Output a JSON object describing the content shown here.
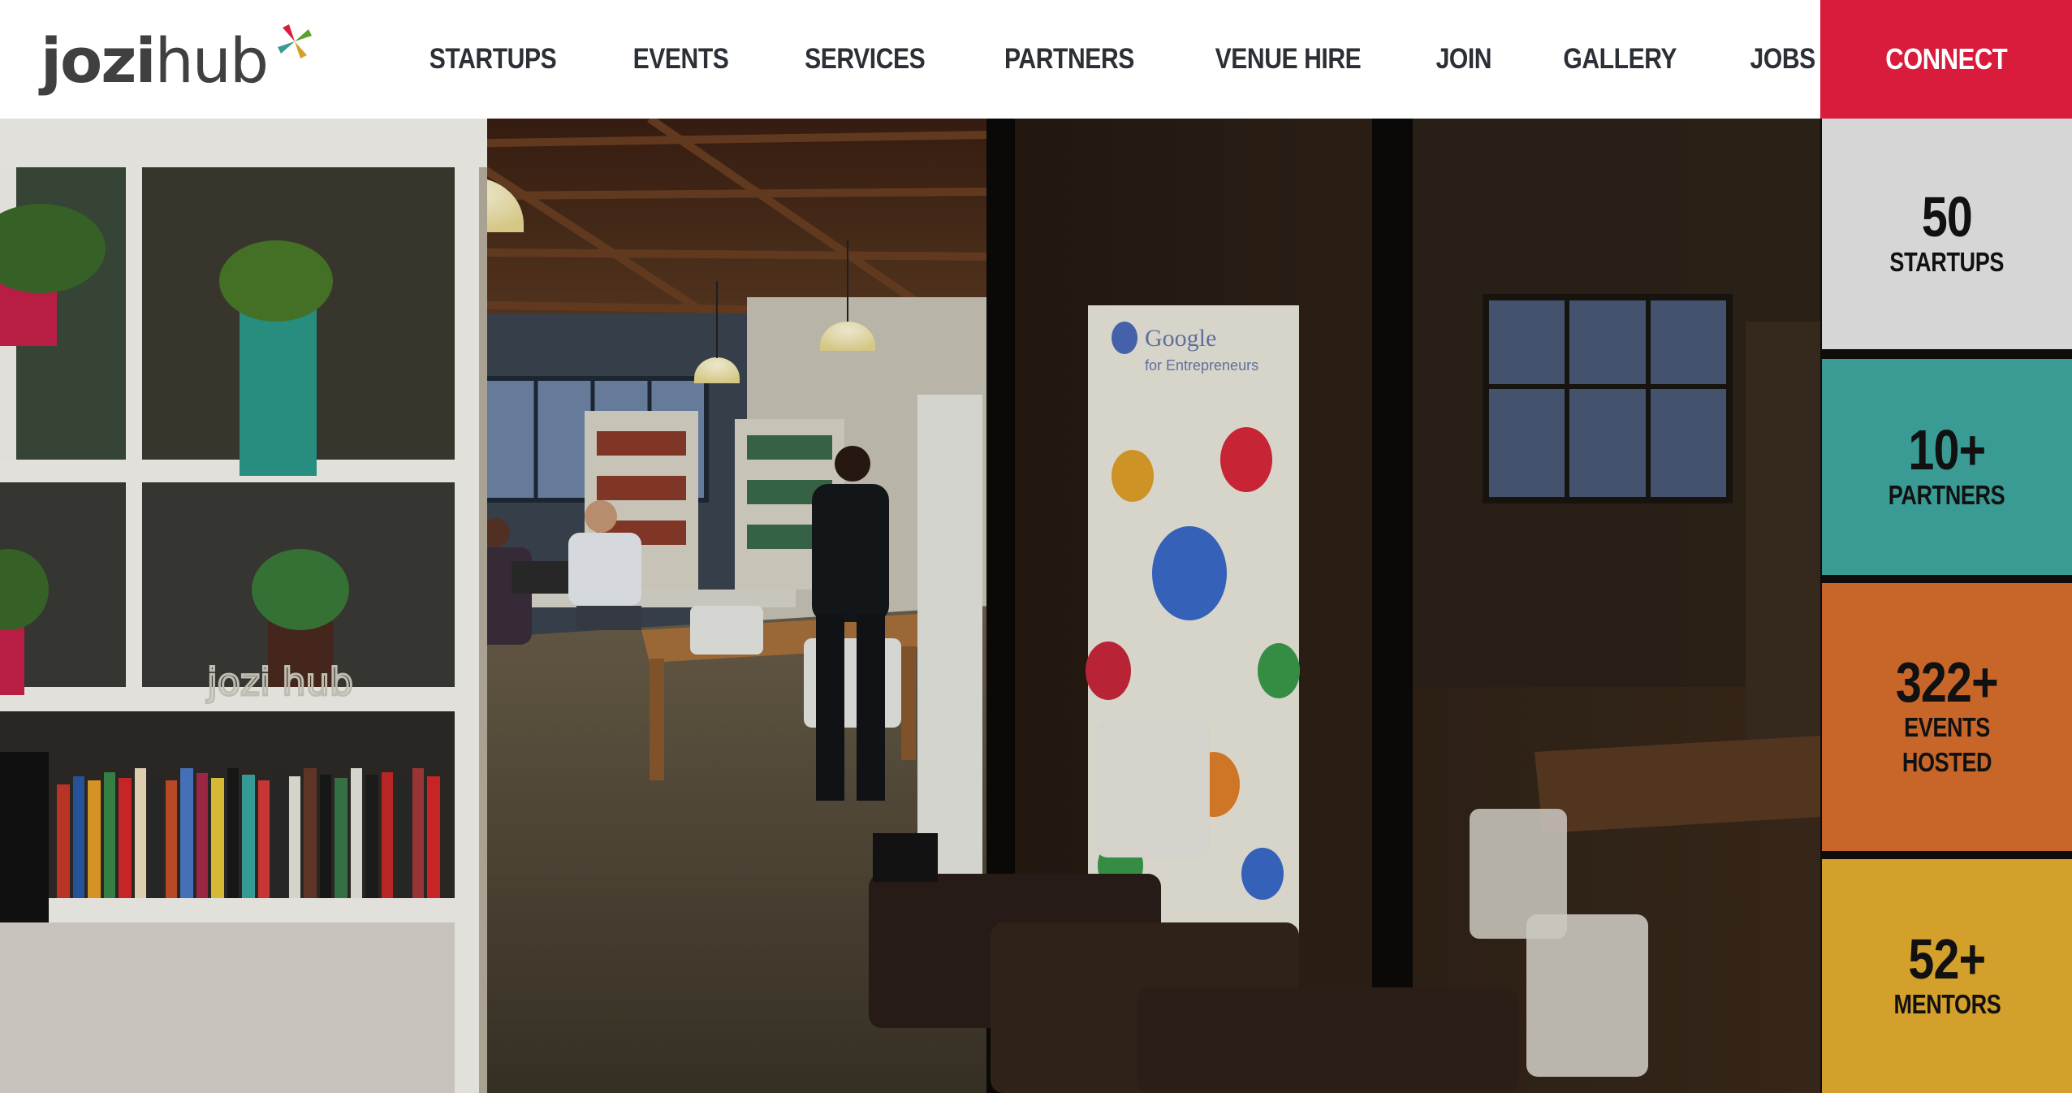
{
  "brand": {
    "logo_bold": "jozi",
    "logo_light": "hub",
    "mark_colors": [
      "#da1c3c",
      "#3a9a94",
      "#d4a02c",
      "#5aa02c"
    ]
  },
  "nav": {
    "items": [
      {
        "label": "STARTUPS"
      },
      {
        "label": "EVENTS"
      },
      {
        "label": "SERVICES"
      },
      {
        "label": "PARTNERS"
      },
      {
        "label": "VENUE HIRE"
      },
      {
        "label": "JOIN"
      },
      {
        "label": "GALLERY"
      },
      {
        "label": "JOBS"
      }
    ],
    "cta_label": "CONNECT"
  },
  "stats": [
    {
      "value": "50",
      "label": "STARTUPS",
      "color": "#d6d6d6"
    },
    {
      "value": "10+",
      "label": "PARTNERS",
      "color": "#3a9a94"
    },
    {
      "value": "322+",
      "label": "EVENTS HOSTED",
      "color": "#c8662a"
    },
    {
      "value": "52+",
      "label": "MENTORS",
      "color": "#d4a02c"
    }
  ],
  "colors": {
    "accent": "#da1c3c",
    "nav_text": "#2b2f36"
  }
}
